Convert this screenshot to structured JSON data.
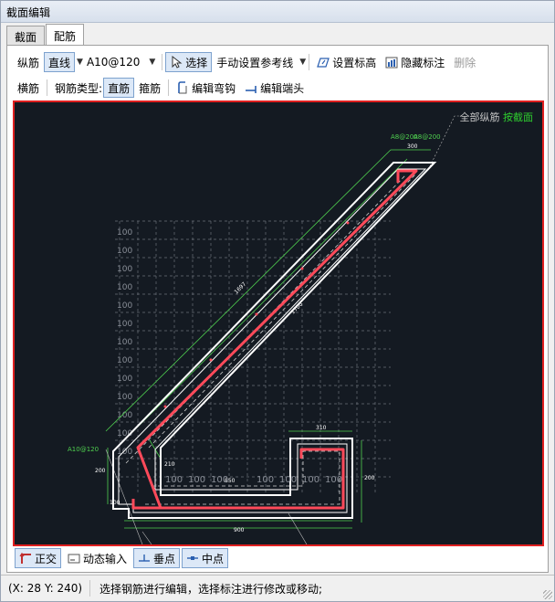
{
  "window": {
    "title": "截面编辑"
  },
  "tabs": [
    {
      "label": "截面"
    },
    {
      "label": "配筋"
    }
  ],
  "toolbar1": {
    "longitudinal": "纵筋",
    "line_mode": "直线",
    "rebar_spec": "A10@120",
    "select": "选择",
    "manual_ref": "手动设置参考线",
    "set_elevation": "设置标高",
    "hide_dimensions": "隐藏标注",
    "delete": "删除"
  },
  "toolbar2": {
    "transverse": "横筋",
    "rebar_type_label": "钢筋类型:",
    "straight": "直筋",
    "stirrup": "箍筋",
    "edit_hook": "编辑弯钩",
    "edit_end": "编辑端头"
  },
  "canvas": {
    "hint_prefix": "全部纵筋",
    "hint_link": "按截面",
    "labels": {
      "top_a": "A8@200",
      "top_b": "A8@200",
      "left_spec": "A10@120",
      "dim_top_w": "300",
      "dim_diag1": "1697",
      "dim_diag2": "1700",
      "dim_right_w": "310",
      "dim_left_h": "200",
      "dim_right_h": "200",
      "dim_bottom": "850",
      "dim_bottom2": "900",
      "dim_small1": "100",
      "dim_small2": "210",
      "grid_label": "100"
    }
  },
  "snapbar": {
    "ortho": "正交",
    "dynamic_input": "动态输入",
    "perpendicular": "垂点",
    "midpoint": "中点"
  },
  "status": {
    "coord": "(X: 28 Y: 240)",
    "message": "选择钢筋进行编辑，选择标注进行修改或移动;"
  },
  "colors": {
    "canvas_bg": "#141a22",
    "rebar_red": "#ff4a5a",
    "outline_white": "#ffffff",
    "dim_green": "#4fd04f",
    "frame_red": "#e02020"
  }
}
